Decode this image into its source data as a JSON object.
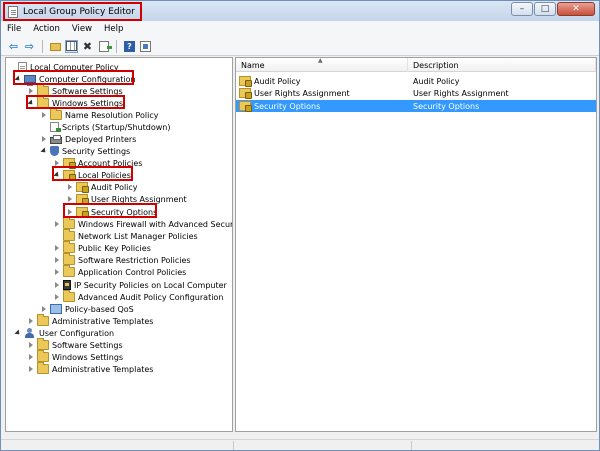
{
  "window": {
    "title": "Local Group Policy Editor",
    "controls": {
      "minimize": "–",
      "maximize": "□",
      "close": "✕"
    }
  },
  "menu": {
    "items": [
      "File",
      "Action",
      "View",
      "Help"
    ]
  },
  "toolbar": {
    "buttons": [
      "back-arrow-icon",
      "forward-arrow-icon",
      "up-folder-icon",
      "show-hide-tree-icon",
      "delete-icon",
      "export-list-icon",
      "help-icon",
      "properties-icon"
    ]
  },
  "tree": {
    "items": [
      {
        "label": "Local Computer Policy",
        "icon": "policy-doc-icon"
      },
      {
        "label": "Computer Configuration",
        "icon": "computer-icon"
      },
      {
        "label": "Software Settings",
        "icon": "folder-icon"
      },
      {
        "label": "Windows Settings",
        "icon": "folder-icon"
      },
      {
        "label": "Name Resolution Policy",
        "icon": "folder-icon"
      },
      {
        "label": "Scripts (Startup/Shutdown)",
        "icon": "script-icon"
      },
      {
        "label": "Deployed Printers",
        "icon": "printer-icon"
      },
      {
        "label": "Security Settings",
        "icon": "security-icon"
      },
      {
        "label": "Account Policies",
        "icon": "folder-lock-icon"
      },
      {
        "label": "Local Policies",
        "icon": "folder-lock-icon"
      },
      {
        "label": "Audit Policy",
        "icon": "folder-lock-icon"
      },
      {
        "label": "User Rights Assignment",
        "icon": "folder-lock-icon"
      },
      {
        "label": "Security Options",
        "icon": "folder-lock-icon"
      },
      {
        "label": "Windows Firewall with Advanced Security",
        "icon": "folder-icon"
      },
      {
        "label": "Network List Manager Policies",
        "icon": "folder-icon"
      },
      {
        "label": "Public Key Policies",
        "icon": "folder-icon"
      },
      {
        "label": "Software Restriction Policies",
        "icon": "folder-icon"
      },
      {
        "label": "Application Control Policies",
        "icon": "folder-icon"
      },
      {
        "label": "IP Security Policies on Local Computer",
        "icon": "ip-security-icon"
      },
      {
        "label": "Advanced Audit Policy Configuration",
        "icon": "folder-icon"
      },
      {
        "label": "Policy-based QoS",
        "icon": "qos-icon"
      },
      {
        "label": "Administrative Templates",
        "icon": "folder-icon"
      },
      {
        "label": "User Configuration",
        "icon": "user-icon"
      },
      {
        "label": "Software Settings",
        "icon": "folder-icon"
      },
      {
        "label": "Windows Settings",
        "icon": "folder-icon"
      },
      {
        "label": "Administrative Templates",
        "icon": "folder-icon"
      }
    ]
  },
  "list": {
    "columns": {
      "name": "Name",
      "description": "Description"
    },
    "rows": [
      {
        "name": "Audit Policy",
        "description": "Audit Policy",
        "selected": false
      },
      {
        "name": "User Rights Assignment",
        "description": "User Rights Assignment",
        "selected": false
      },
      {
        "name": "Security Options",
        "description": "Security Options",
        "selected": true
      }
    ]
  },
  "colors": {
    "highlight_box": "#d00000",
    "selection": "#3399ff"
  }
}
